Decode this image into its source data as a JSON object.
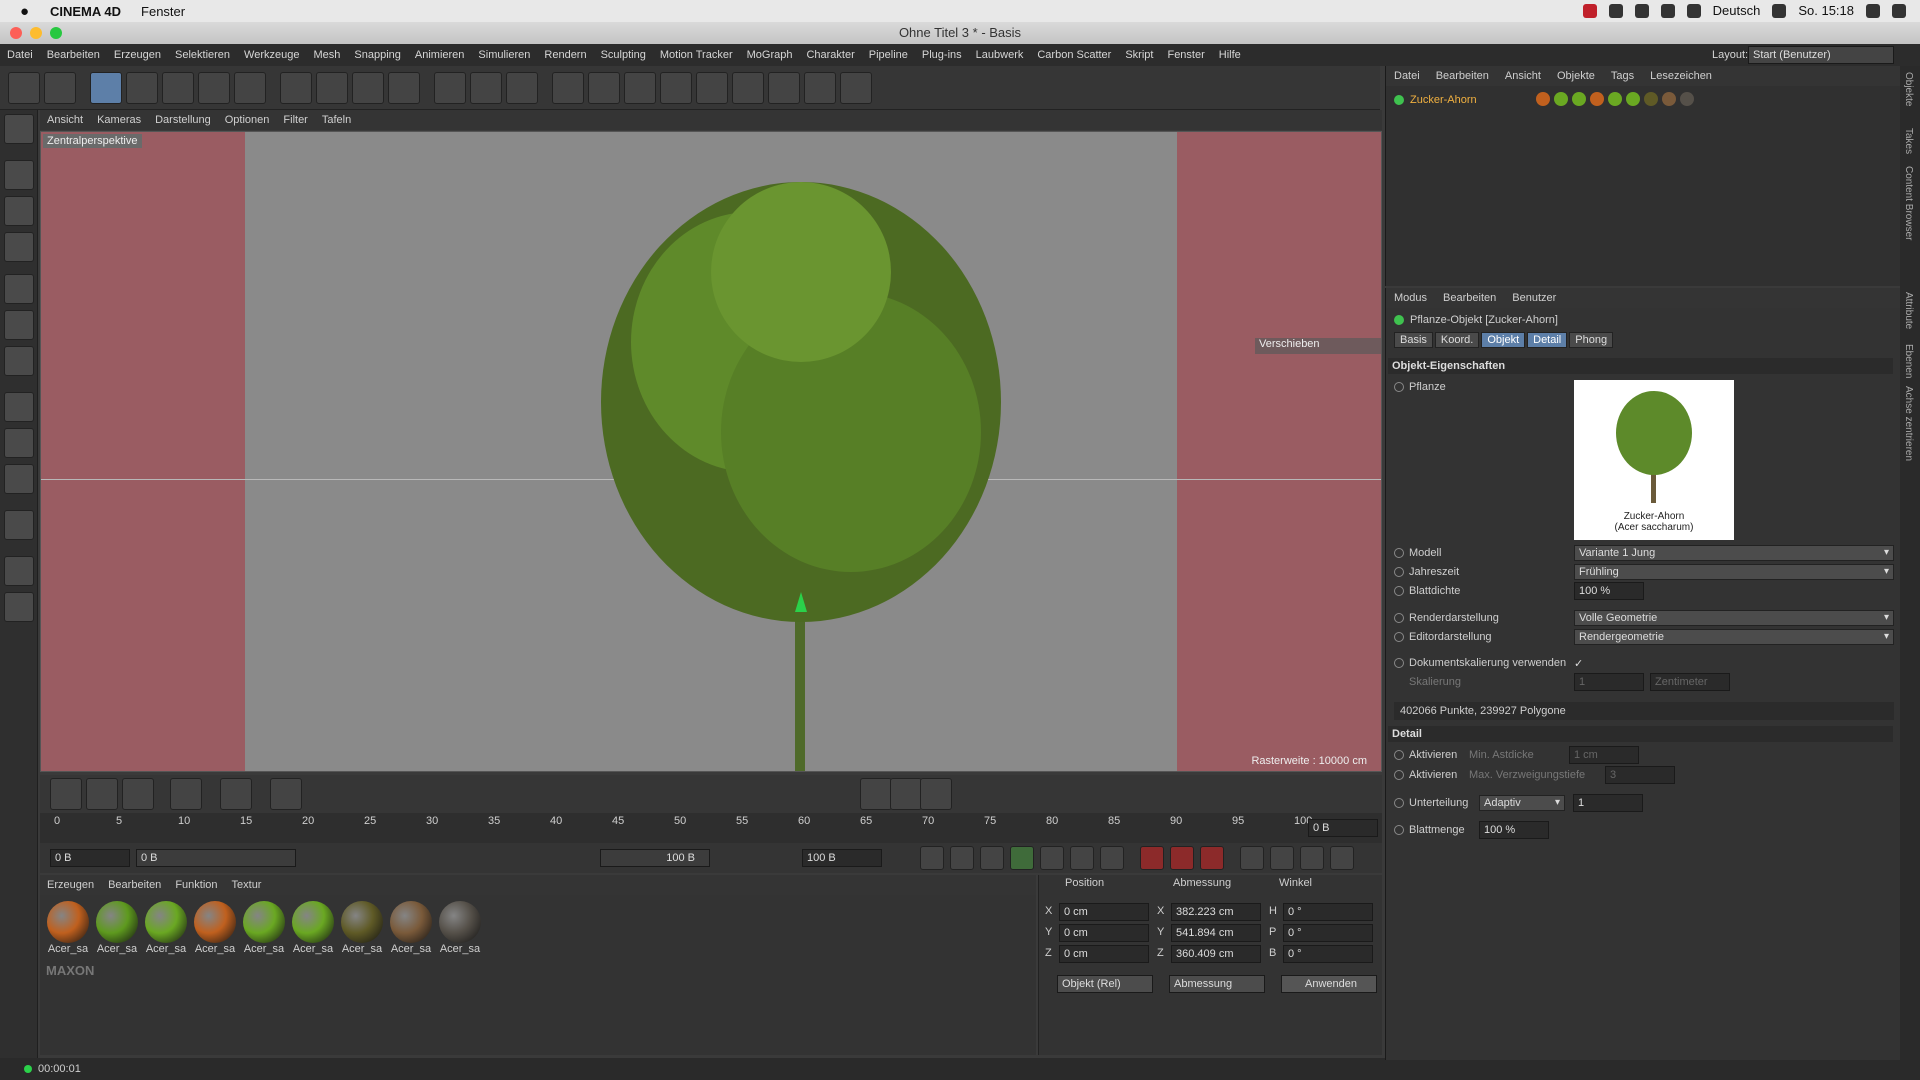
{
  "mac": {
    "app": "CINEMA 4D",
    "menu": "Fenster",
    "lang": "Deutsch",
    "clock": "So. 15:18"
  },
  "window": {
    "title": "Ohne Titel 3 * - Basis"
  },
  "menu": [
    "Datei",
    "Bearbeiten",
    "Erzeugen",
    "Selektieren",
    "Werkzeuge",
    "Mesh",
    "Snapping",
    "Animieren",
    "Simulieren",
    "Rendern",
    "Sculpting",
    "Motion Tracker",
    "MoGraph",
    "Charakter",
    "Pipeline",
    "Plug-ins",
    "Laubwerk",
    "Carbon Scatter",
    "Skript",
    "Fenster",
    "Hilfe"
  ],
  "layout": {
    "label": "Layout:",
    "value": "Start (Benutzer)"
  },
  "viewport": {
    "menu": [
      "Ansicht",
      "Kameras",
      "Darstellung",
      "Optionen",
      "Filter",
      "Tafeln"
    ],
    "label": "Zentralperspektive",
    "move_label": "Verschieben",
    "raster": "Rasterweite : 10000 cm"
  },
  "timeline": {
    "ticks": [
      "0",
      "5",
      "10",
      "15",
      "20",
      "25",
      "30",
      "35",
      "40",
      "45",
      "50",
      "55",
      "60",
      "65",
      "70",
      "75",
      "80",
      "85",
      "90",
      "95",
      "100"
    ],
    "frame_end": "0 B",
    "start": "0 B",
    "range_start": "0 B",
    "range_end": "100 B",
    "end": "100 B"
  },
  "materials": {
    "menu": [
      "Erzeugen",
      "Bearbeiten",
      "Funktion",
      "Textur"
    ],
    "items": [
      {
        "label": "Acer_sa",
        "color": "#c0601e"
      },
      {
        "label": "Acer_sa",
        "color": "#5e9a1e"
      },
      {
        "label": "Acer_sa",
        "color": "#6aa822"
      },
      {
        "label": "Acer_sa",
        "color": "#c0601e"
      },
      {
        "label": "Acer_sa",
        "color": "#6aa822"
      },
      {
        "label": "Acer_sa",
        "color": "#6aa822"
      },
      {
        "label": "Acer_sa",
        "color": "#5f5a26"
      },
      {
        "label": "Acer_sa",
        "color": "#7a5a3a"
      },
      {
        "label": "Acer_sa",
        "color": "#555049"
      }
    ]
  },
  "coords": {
    "headers": [
      "Position",
      "Abmessung",
      "Winkel"
    ],
    "rows": [
      {
        "axis": "X",
        "pos": "0 cm",
        "dim_axis": "X",
        "dim": "382.223 cm",
        "ang_axis": "H",
        "ang": "0 °"
      },
      {
        "axis": "Y",
        "pos": "0 cm",
        "dim_axis": "Y",
        "dim": "541.894 cm",
        "ang_axis": "P",
        "ang": "0 °"
      },
      {
        "axis": "Z",
        "pos": "0 cm",
        "dim_axis": "Z",
        "dim": "360.409 cm",
        "ang_axis": "B",
        "ang": "0 °"
      }
    ],
    "mode": "Objekt (Rel)",
    "size_mode": "Abmessung",
    "apply": "Anwenden"
  },
  "status": {
    "time": "00:00:01"
  },
  "object_manager": {
    "menu": [
      "Datei",
      "Bearbeiten",
      "Ansicht",
      "Objekte",
      "Tags",
      "Lesezeichen"
    ],
    "object": "Zucker-Ahorn"
  },
  "attributes": {
    "menu": [
      "Modus",
      "Bearbeiten",
      "Benutzer"
    ],
    "title": "Pflanze-Objekt [Zucker-Ahorn]",
    "tabs": [
      "Basis",
      "Koord.",
      "Objekt",
      "Detail",
      "Phong"
    ],
    "section": "Objekt-Eigenschaften",
    "plant_label": "Pflanze",
    "preview_caption1": "Zucker-Ahorn",
    "preview_caption2": "(Acer saccharum)",
    "modell_label": "Modell",
    "modell": "Variante 1 Jung",
    "season_label": "Jahreszeit",
    "season": "Frühling",
    "leaf_label": "Blattdichte",
    "leaf": "100 %",
    "render_label": "Renderdarstellung",
    "render": "Volle Geometrie",
    "editor_label": "Editordarstellung",
    "editor": "Rendergeometrie",
    "docscale_label": "Dokumentskalierung verwenden",
    "scale_label": "Skalierung",
    "scale": "1",
    "unit": "Zentimeter",
    "points": "402066 Punkte, 239927 Polygone",
    "detail_section": "Detail",
    "act1": "Aktivieren",
    "min_branch": "Min. Astdicke",
    "min_branch_val": "1 cm",
    "act2": "Aktivieren",
    "max_branch": "Max. Verzweigungstiefe",
    "max_branch_val": "3",
    "subdiv_label": "Unterteilung",
    "subdiv": "Adaptiv",
    "subdiv_val": "1",
    "leafamount_label": "Blattmenge",
    "leafamount": "100 %"
  },
  "side_tabs": [
    "Objekte",
    "Takes",
    "Content Browser",
    "Attribute",
    "Ebenen",
    "Achse zentrieren"
  ]
}
